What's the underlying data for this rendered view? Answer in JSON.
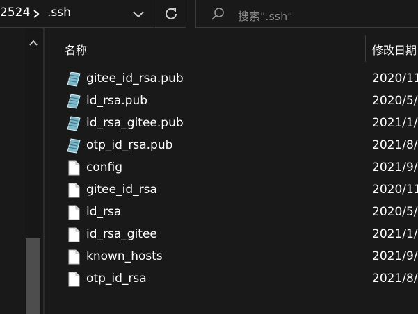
{
  "address": {
    "crumbs": [
      "2524",
      ".ssh"
    ]
  },
  "search": {
    "placeholder": "搜索\".ssh\""
  },
  "columns": {
    "name": "名称",
    "date_modified": "修改日期"
  },
  "files": [
    {
      "name": "gitee_id_rsa.pub",
      "date": "2020/11",
      "icon": "publisher-file-icon"
    },
    {
      "name": "id_rsa.pub",
      "date": "2020/5/",
      "icon": "publisher-file-icon"
    },
    {
      "name": "id_rsa_gitee.pub",
      "date": "2021/1/",
      "icon": "publisher-file-icon"
    },
    {
      "name": "otp_id_rsa.pub",
      "date": "2021/8/",
      "icon": "publisher-file-icon"
    },
    {
      "name": "config",
      "date": "2021/9/",
      "icon": "blank-file-icon"
    },
    {
      "name": "gitee_id_rsa",
      "date": "2020/11",
      "icon": "blank-file-icon"
    },
    {
      "name": "id_rsa",
      "date": "2020/5/",
      "icon": "blank-file-icon"
    },
    {
      "name": "id_rsa_gitee",
      "date": "2021/1/",
      "icon": "blank-file-icon"
    },
    {
      "name": "known_hosts",
      "date": "2021/9/",
      "icon": "blank-file-icon"
    },
    {
      "name": "otp_id_rsa",
      "date": "2021/8/",
      "icon": "blank-file-icon"
    }
  ],
  "colors": {
    "background": "#191919",
    "text": "#ffffff",
    "muted": "#8a8a8a",
    "scroll_thumb": "#4d4d4d"
  }
}
